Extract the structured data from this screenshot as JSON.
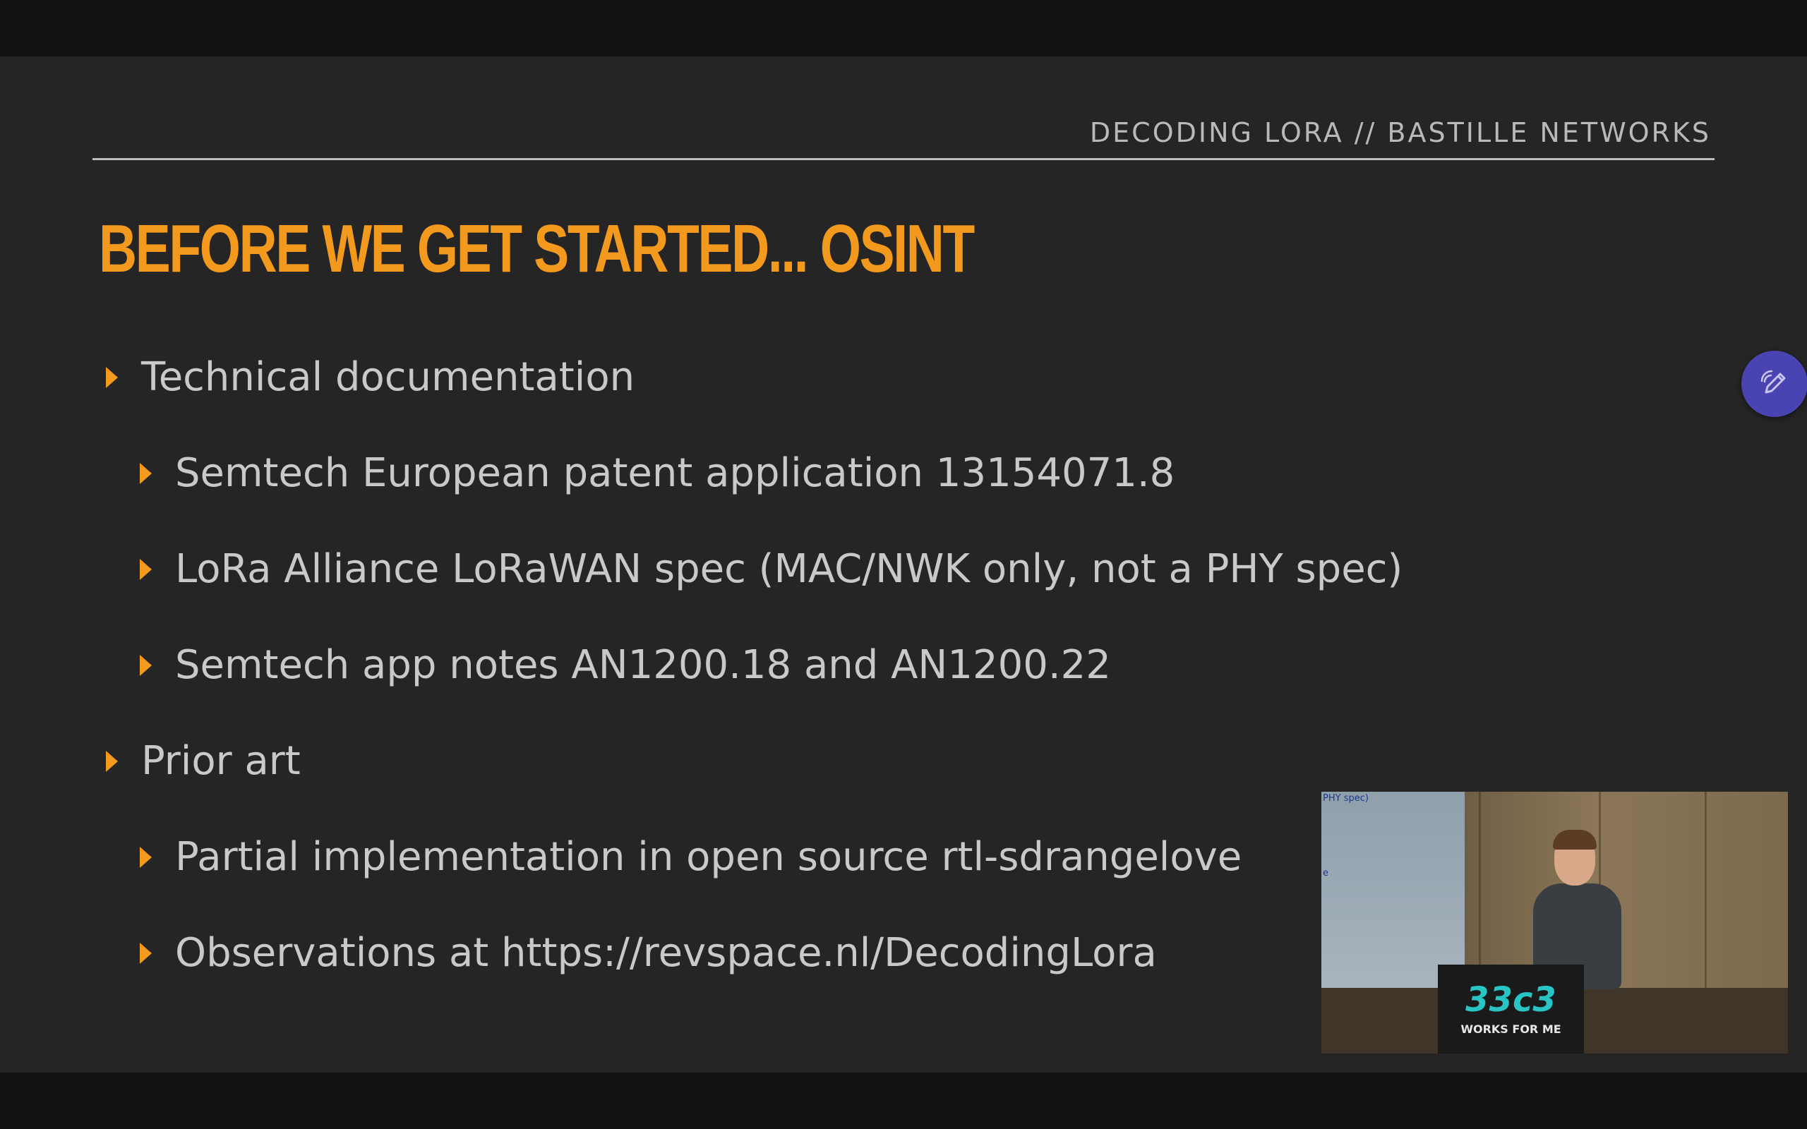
{
  "slide": {
    "header": "DECODING LORA // BASTILLE NETWORKS",
    "title": "BEFORE WE GET STARTED... OSINT",
    "bullets": [
      {
        "level": 1,
        "text": "Technical documentation"
      },
      {
        "level": 2,
        "text": "Semtech European patent application 13154071.8"
      },
      {
        "level": 2,
        "text": "LoRa Alliance LoRaWAN spec (MAC/NWK only, not a PHY spec)"
      },
      {
        "level": 2,
        "text": "Semtech app notes AN1200.18 and AN1200.22"
      },
      {
        "level": 1,
        "text": "Prior art"
      },
      {
        "level": 2,
        "text": "Partial implementation in open source rtl-sdrangelove"
      },
      {
        "level": 2,
        "text": "Observations at https://revspace.nl/DecodingLora"
      }
    ]
  },
  "edit_button": {
    "icon": "pencil-icon"
  },
  "speaker_video": {
    "screen_text_top": "PHY spec)",
    "screen_text_mid": "e",
    "podium_logo": "33c3",
    "podium_sub": "WORKS FOR ME"
  },
  "colors": {
    "accent": "#f39a1e",
    "slide_bg": "#252525",
    "text": "#c9c9c9",
    "header_text": "#b9b9b9",
    "edit_button": "#4a44b3"
  }
}
